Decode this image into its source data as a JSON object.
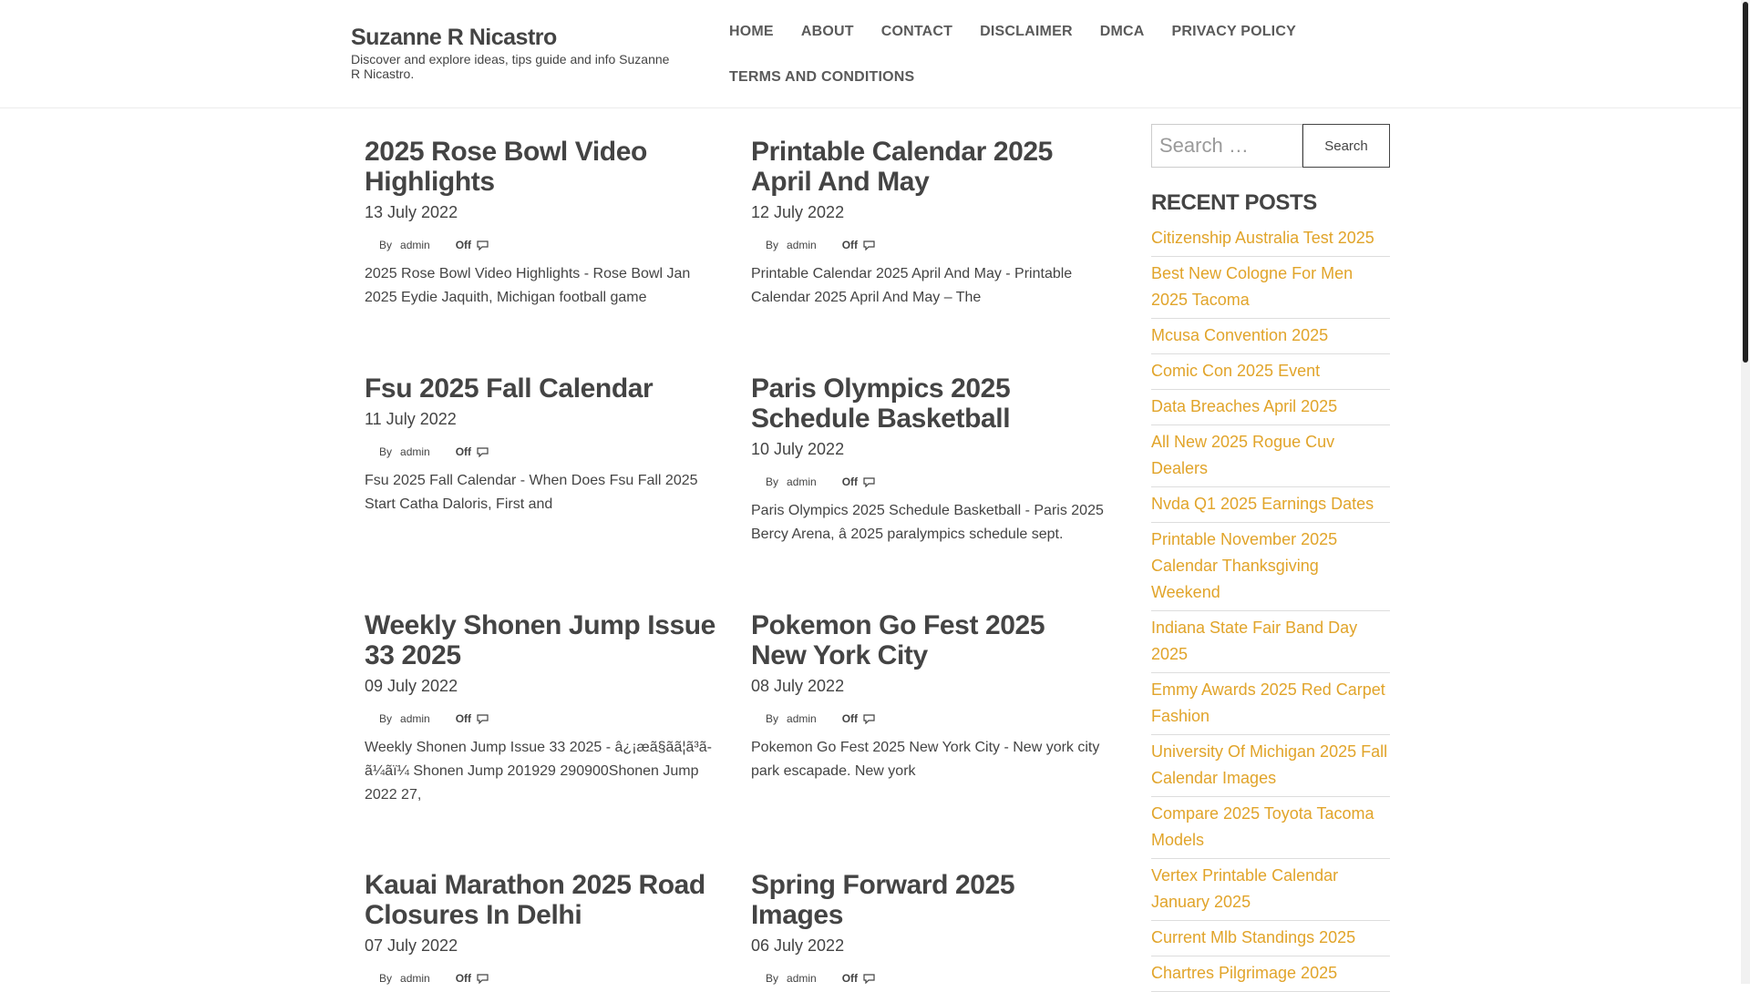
{
  "site": {
    "title": "Suzanne R Nicastro",
    "description": "Discover and explore ideas, tips guide and info Suzanne R Nicastro."
  },
  "nav": {
    "items": [
      {
        "label": "HOME"
      },
      {
        "label": "ABOUT"
      },
      {
        "label": "CONTACT"
      },
      {
        "label": "DISCLAIMER"
      },
      {
        "label": "DMCA"
      },
      {
        "label": "PRIVACY POLICY"
      },
      {
        "label": "TERMS AND CONDITIONS"
      }
    ]
  },
  "posts": [
    {
      "title": "2025 Rose Bowl Video Highlights",
      "date": "13 July 2022",
      "by": "By",
      "author": "admin",
      "comments": "Off",
      "excerpt": "2025 Rose Bowl Video Highlights - Rose Bowl Jan 2025 Eydie Jaquith, Michigan football game"
    },
    {
      "title": "Printable Calendar 2025 April And May",
      "date": "12 July 2022",
      "by": "By",
      "author": "admin",
      "comments": "Off",
      "excerpt": "Printable Calendar 2025 April And May - Printable Calendar 2025 April And May – The"
    },
    {
      "title": "Fsu 2025 Fall Calendar",
      "date": "11 July 2022",
      "by": "By",
      "author": "admin",
      "comments": "Off",
      "excerpt": "Fsu 2025 Fall Calendar - When Does Fsu Fall 2025 Start Catha Daloris, First and"
    },
    {
      "title": "Paris Olympics 2025 Schedule Basketball",
      "date": "10 July 2022",
      "by": "By",
      "author": "admin",
      "comments": "Off",
      "excerpt": "Paris Olympics 2025 Schedule Basketball - Paris 2025 Bercy Arena,  â 2025 paralympics schedule sept."
    },
    {
      "title": "Weekly Shonen Jump Issue 33 2025",
      "date": "09 July 2022",
      "by": "By",
      "author": "admin",
      "comments": "Off",
      "excerpt": "Weekly Shonen Jump Issue 33 2025 - â¿¡æã§ãã¦ã³ã-ã¼ãï¼ Shonen Jump 201929 290900Shonen Jump 2022 27,"
    },
    {
      "title": "Pokemon Go Fest 2025 New York City",
      "date": "08 July 2022",
      "by": "By",
      "author": "admin",
      "comments": "Off",
      "excerpt": "Pokemon Go Fest 2025 New York City - New york city park escapade. New york"
    },
    {
      "title": "Kauai Marathon 2025 Road Closures In Delhi",
      "date": "07 July 2022",
      "by": "By",
      "author": "admin",
      "comments": "Off",
      "excerpt": ""
    },
    {
      "title": "Spring Forward 2025 Images",
      "date": "06 July 2022",
      "by": "By",
      "author": "admin",
      "comments": "Off",
      "excerpt": ""
    }
  ],
  "sidebar": {
    "search_placeholder": "Search …",
    "search_button": "Search",
    "recent_title": "RECENT POSTS",
    "recent": [
      "Citizenship Australia Test 2025",
      "Best New Cologne For Men 2025 Tacoma",
      "Mcusa Convention 2025",
      "Comic Con 2025 Event",
      "Data Breaches April 2025",
      "All New 2025 Rogue Cuv Dealers",
      "Nvda Q1 2025 Earnings Dates",
      "Printable November 2025 Calendar Thanksgiving Weekend",
      "Indiana State Fair Band Day 2025",
      "Emmy Awards 2025 Red Carpet Fashion",
      "University Of Michigan 2025 Fall Calendar Images",
      "Compare 2025 Toyota Tacoma Models",
      "Vertex Printable Calendar January 2025",
      "Current Mlb Standings 2025",
      "Chartres Pilgrimage 2025"
    ]
  },
  "colors": {
    "link_accent": "#e1a42a",
    "text": "#444444"
  }
}
